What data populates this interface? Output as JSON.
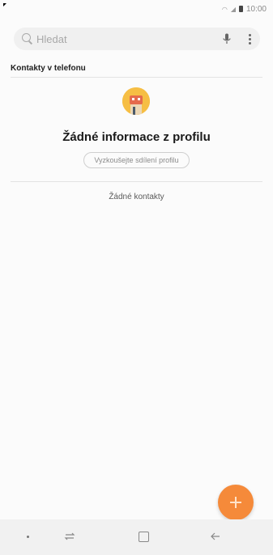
{
  "status_bar": {
    "time": "10:00",
    "signal_icon": "signal-icon",
    "battery_icon": "battery-icon"
  },
  "search": {
    "placeholder": "Hledat"
  },
  "section": {
    "header": "Kontakty v telefonu"
  },
  "profile": {
    "title": "Žádné informace z profilu",
    "share_button": "Vyzkoušejte sdílení profilu"
  },
  "contacts": {
    "empty_text": "Žádné kontakty"
  },
  "colors": {
    "accent": "#f58a3a",
    "avatar_bg": "#f6be44"
  },
  "nav": {
    "items": [
      "nav-dot",
      "recent-apps-icon",
      "home-icon",
      "back-icon"
    ]
  }
}
